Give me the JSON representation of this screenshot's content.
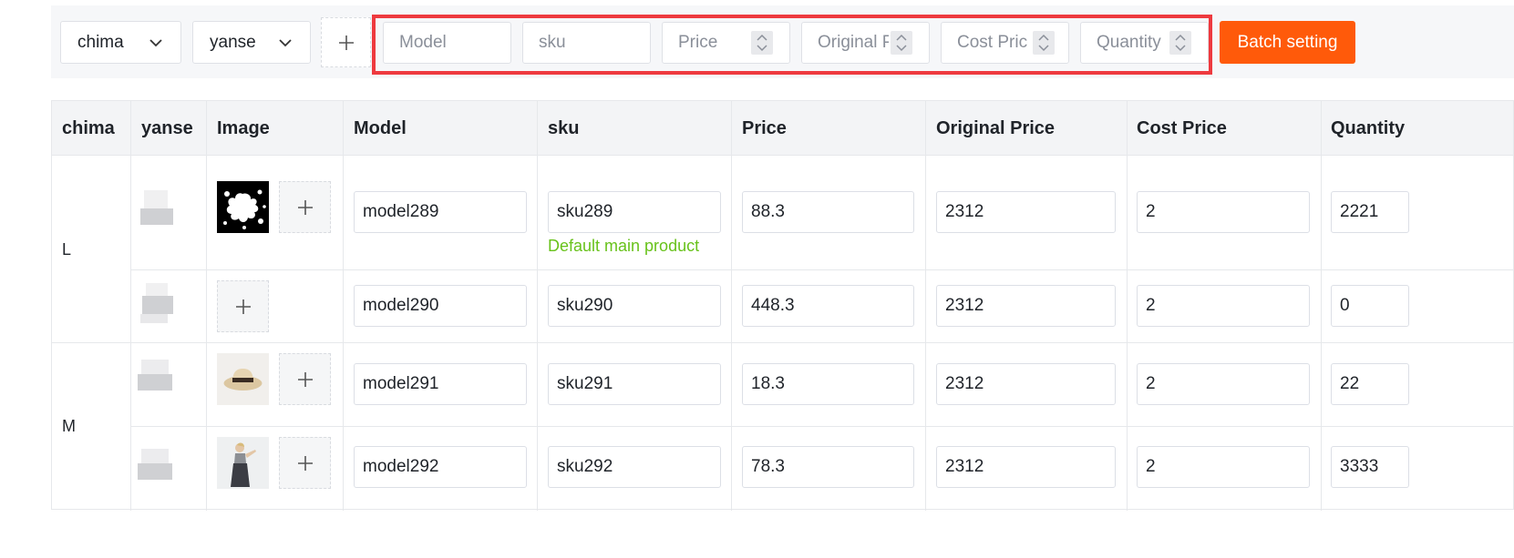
{
  "toolbar": {
    "spec_selects": [
      {
        "value": "chima"
      },
      {
        "value": "yanse"
      }
    ],
    "add_spec_label": "+",
    "batch_fields": [
      {
        "placeholder": "Model",
        "has_stepper": false
      },
      {
        "placeholder": "sku",
        "has_stepper": false
      },
      {
        "placeholder": "Price",
        "has_stepper": true
      },
      {
        "placeholder": "Original Price",
        "has_stepper": true
      },
      {
        "placeholder": "Cost Price",
        "has_stepper": true
      },
      {
        "placeholder": "Quantity",
        "has_stepper": true
      }
    ],
    "batch_button_label": "Batch setting",
    "highlight_color": "#ee3a3f",
    "accent_color": "#ff5a0a"
  },
  "table": {
    "columns": [
      "chima",
      "yanse",
      "Image",
      "Model",
      "sku",
      "Price",
      "Original Price",
      "Cost Price",
      "Quantity"
    ],
    "groups": [
      {
        "chima": "L"
      },
      {
        "chima": "M"
      }
    ],
    "rows": [
      {
        "model": "model289",
        "sku": "sku289",
        "price": "88.3",
        "original_price": "2312",
        "cost_price": "2",
        "quantity": "2221",
        "image": "splash-icon",
        "note": "Default main product"
      },
      {
        "model": "model290",
        "sku": "sku290",
        "price": "448.3",
        "original_price": "2312",
        "cost_price": "2",
        "quantity": "0",
        "image": null,
        "note": ""
      },
      {
        "model": "model291",
        "sku": "sku291",
        "price": "18.3",
        "original_price": "2312",
        "cost_price": "2",
        "quantity": "22",
        "image": "hat-photo",
        "note": ""
      },
      {
        "model": "model292",
        "sku": "sku292",
        "price": "78.3",
        "original_price": "2312",
        "cost_price": "2",
        "quantity": "3333",
        "image": "model-photo",
        "note": ""
      }
    ],
    "note_color": "#68c21b"
  }
}
